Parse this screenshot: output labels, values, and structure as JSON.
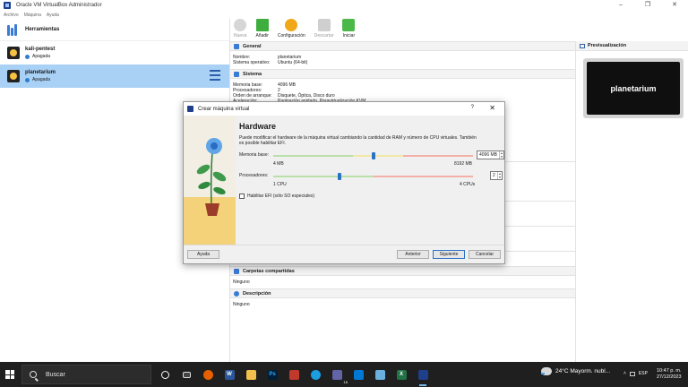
{
  "window": {
    "title": "Oracle VM VirtualBox Administrador",
    "controls": [
      "–",
      "❐",
      "✕"
    ]
  },
  "menu": [
    "Archivo",
    "Máquina",
    "Ayuda"
  ],
  "sidebar": {
    "tools_label": "Herramientas",
    "vms": [
      {
        "name": "kali-pentest",
        "status": "Apagada"
      },
      {
        "name": "planetarium",
        "status": "Apagada"
      }
    ]
  },
  "toolbar": {
    "new": "Nueva",
    "add": "Añadir",
    "settings": "Configuración",
    "discard": "Descartar",
    "start": "Iniciar"
  },
  "details": {
    "general": {
      "title": "General",
      "rows": [
        {
          "k": "Nombre:",
          "v": "planetarium"
        },
        {
          "k": "Sistema operativo:",
          "v": "Ubuntu (64-bit)"
        }
      ]
    },
    "system": {
      "title": "Sistema",
      "rows": [
        {
          "k": "Memoria base:",
          "v": "4096 MB"
        },
        {
          "k": "Procesadores:",
          "v": "2"
        },
        {
          "k": "Orden de arranque:",
          "v": "Disquete, Óptica, Disco duro"
        },
        {
          "k": "Aceleración:",
          "v": "Paginación anidada, Paravirtualización KVM"
        }
      ]
    },
    "shared_folders": {
      "title": "Carpetas compartidas",
      "value": "Ninguno"
    },
    "description": {
      "title": "Descripción",
      "value": "Ninguno"
    }
  },
  "preview": {
    "title": "Previsualización",
    "screen_text": "planetarium"
  },
  "dialog": {
    "title": "Crear máquina virtual",
    "help": "?",
    "close": "✕",
    "heading": "Hardware",
    "description": "Puede modificar el hardware de la máquina virtual cambiando la cantidad de RAM y número de CPU virtuales. También es posible habilitar EFI.",
    "memory": {
      "label": "Memoria base:",
      "value": "4096 MB",
      "min_label": "4 MB",
      "max_label": "8192 MB",
      "fraction": 0.5
    },
    "processors": {
      "label": "Procesadores:",
      "value": "2",
      "min_label": "1 CPU",
      "max_label": "4 CPUs",
      "fraction": 0.333
    },
    "efi_label": "Habilitar EFI (sólo SO especiales)",
    "buttons": {
      "help": "Ayuda",
      "back": "Anterior",
      "next": "Siguiente",
      "cancel": "Cancelar"
    }
  },
  "taskbar": {
    "search_placeholder": "Buscar",
    "weather": "24°C  Mayorm. nubl...",
    "language": "ESP",
    "time": "10:47 p. m.",
    "date": "27/12/2023",
    "badge": "16"
  }
}
